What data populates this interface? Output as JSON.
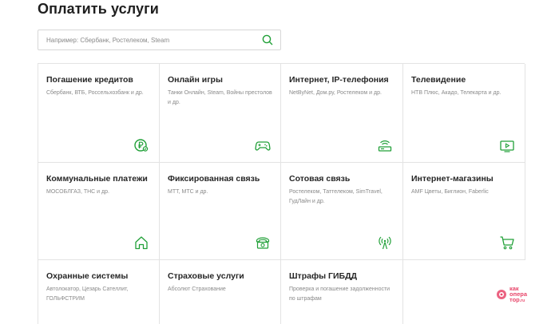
{
  "page": {
    "title": "Оплатить услуги"
  },
  "search": {
    "placeholder": "Например: Сбербанк, Ростелеком, Steam",
    "value": "",
    "icon": "search-icon"
  },
  "accent_color": "#21a038",
  "tiles": [
    {
      "title": "Погашение кредитов",
      "desc": "Сбербанк, ВТБ, Россельхозбанк и др.",
      "icon": "ruble-coin-icon"
    },
    {
      "title": "Онлайн игры",
      "desc": "Танки Онлайн, Steam, Войны престолов и др.",
      "icon": "gamepad-icon"
    },
    {
      "title": "Интернет, IP-телефония",
      "desc": "NetByNet, Дом.ру, Ростелеком и др.",
      "icon": "router-icon"
    },
    {
      "title": "Телевидение",
      "desc": "НТВ Плюс, Акадо, Телекарта и др.",
      "icon": "tv-icon"
    },
    {
      "title": "Коммунальные платежи",
      "desc": "МОСОБЛГАЗ, ТНС и др.",
      "icon": "house-icon"
    },
    {
      "title": "Фиксированная связь",
      "desc": "МТТ, МТС и др.",
      "icon": "landline-phone-icon"
    },
    {
      "title": "Сотовая связь",
      "desc": "Ростелеком, Таттелеком, SimTravel, ГудЛайн и др.",
      "icon": "cell-tower-icon"
    },
    {
      "title": "Интернет-магазины",
      "desc": "AMF Цветы, Биглион, Faberlic",
      "icon": "shopping-cart-icon"
    },
    {
      "title": "Охранные системы",
      "desc": "Автолокатор, Цезарь Сателлит, ГОЛЬФСТРИМ",
      "icon": ""
    },
    {
      "title": "Страховые услуги",
      "desc": "Абсолют Страхование",
      "icon": ""
    },
    {
      "title": "Штрафы ГИБДД",
      "desc": "Проверка и погашение задолженности по штрафам",
      "icon": ""
    }
  ],
  "watermark": {
    "line1": "как",
    "line2": "опера",
    "line3": "тор",
    "suffix": ".ru"
  }
}
